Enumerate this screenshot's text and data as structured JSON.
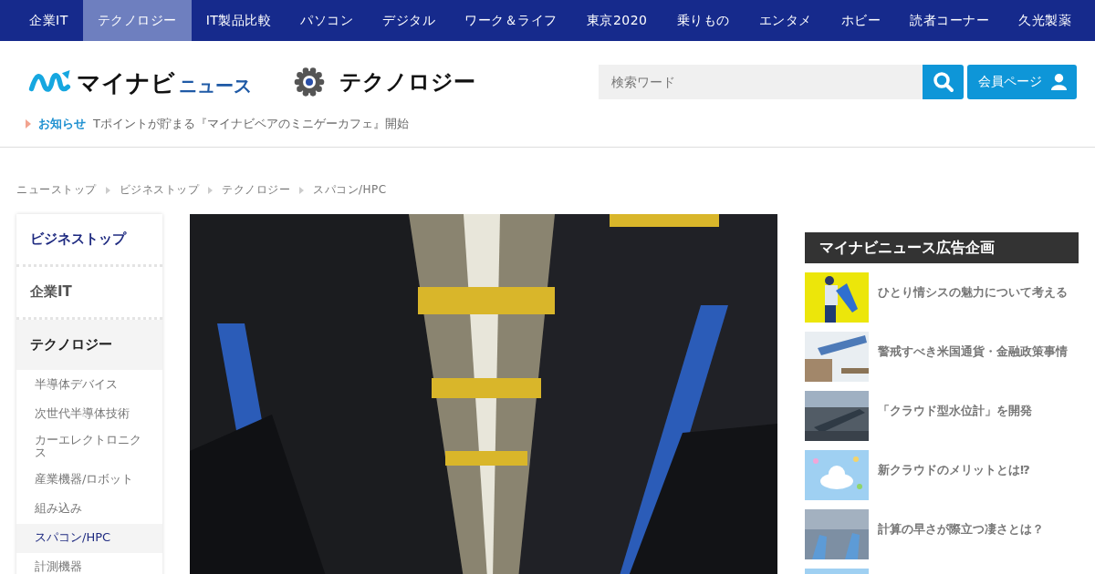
{
  "nav": [
    {
      "label": "企業IT",
      "selected": false
    },
    {
      "label": "テクノロジー",
      "selected": true
    },
    {
      "label": "IT製品比較",
      "selected": false
    },
    {
      "label": "パソコン",
      "selected": false
    },
    {
      "label": "デジタル",
      "selected": false
    },
    {
      "label": "ワーク＆ライフ",
      "selected": false
    },
    {
      "label": "東京2020",
      "selected": false
    },
    {
      "label": "乗りもの",
      "selected": false
    },
    {
      "label": "エンタメ",
      "selected": false
    },
    {
      "label": "ホビー",
      "selected": false
    },
    {
      "label": "読者コーナー",
      "selected": false
    },
    {
      "label": "久光製薬",
      "selected": false
    }
  ],
  "logo": {
    "main": "マイナビ",
    "sub": "ニュース"
  },
  "section_title": "テクノロジー",
  "search": {
    "placeholder": "検索ワード"
  },
  "member_button": "会員ページ",
  "notice": {
    "label": "お知らせ",
    "text": "Tポイントが貯まる『マイナビベアのミニゲーカフェ』開始"
  },
  "breadcrumb": [
    "ニューストップ",
    "ビジネストップ",
    "テクノロジー",
    "スパコン/HPC"
  ],
  "sidebar": {
    "items": [
      {
        "kind": "home",
        "label": "ビジネストップ"
      },
      {
        "kind": "heading",
        "label": "企業IT",
        "selected": false
      },
      {
        "kind": "heading",
        "label": "テクノロジー",
        "selected": true
      },
      {
        "kind": "sub",
        "label": "半導体デバイス",
        "selected": false
      },
      {
        "kind": "sub",
        "label": "次世代半導体技術",
        "selected": false
      },
      {
        "kind": "sub",
        "label": "カーエレクトロニクス",
        "selected": false
      },
      {
        "kind": "sub",
        "label": "産業機器/ロボット",
        "selected": false
      },
      {
        "kind": "sub",
        "label": "組み込み",
        "selected": false
      },
      {
        "kind": "sub",
        "label": "スパコン/HPC",
        "selected": true
      },
      {
        "kind": "sub",
        "label": "計測機器",
        "selected": false
      }
    ]
  },
  "ads": {
    "title": "マイナビニュース広告企画",
    "items": [
      {
        "title": "ひとり情シスの魅力について考える"
      },
      {
        "kind": "coins",
        "title": "警戒すべき米国通貨・金融政策事情"
      },
      {
        "kind": "city",
        "title": "「クラウド型水位計」を開発"
      },
      {
        "kind": "cloud",
        "title": "新クラウドのメリットとは⁉"
      },
      {
        "kind": "hands",
        "title": "計算の早さが際立つ凄さとは？"
      },
      {
        "kind": "cloud"
      }
    ]
  }
}
